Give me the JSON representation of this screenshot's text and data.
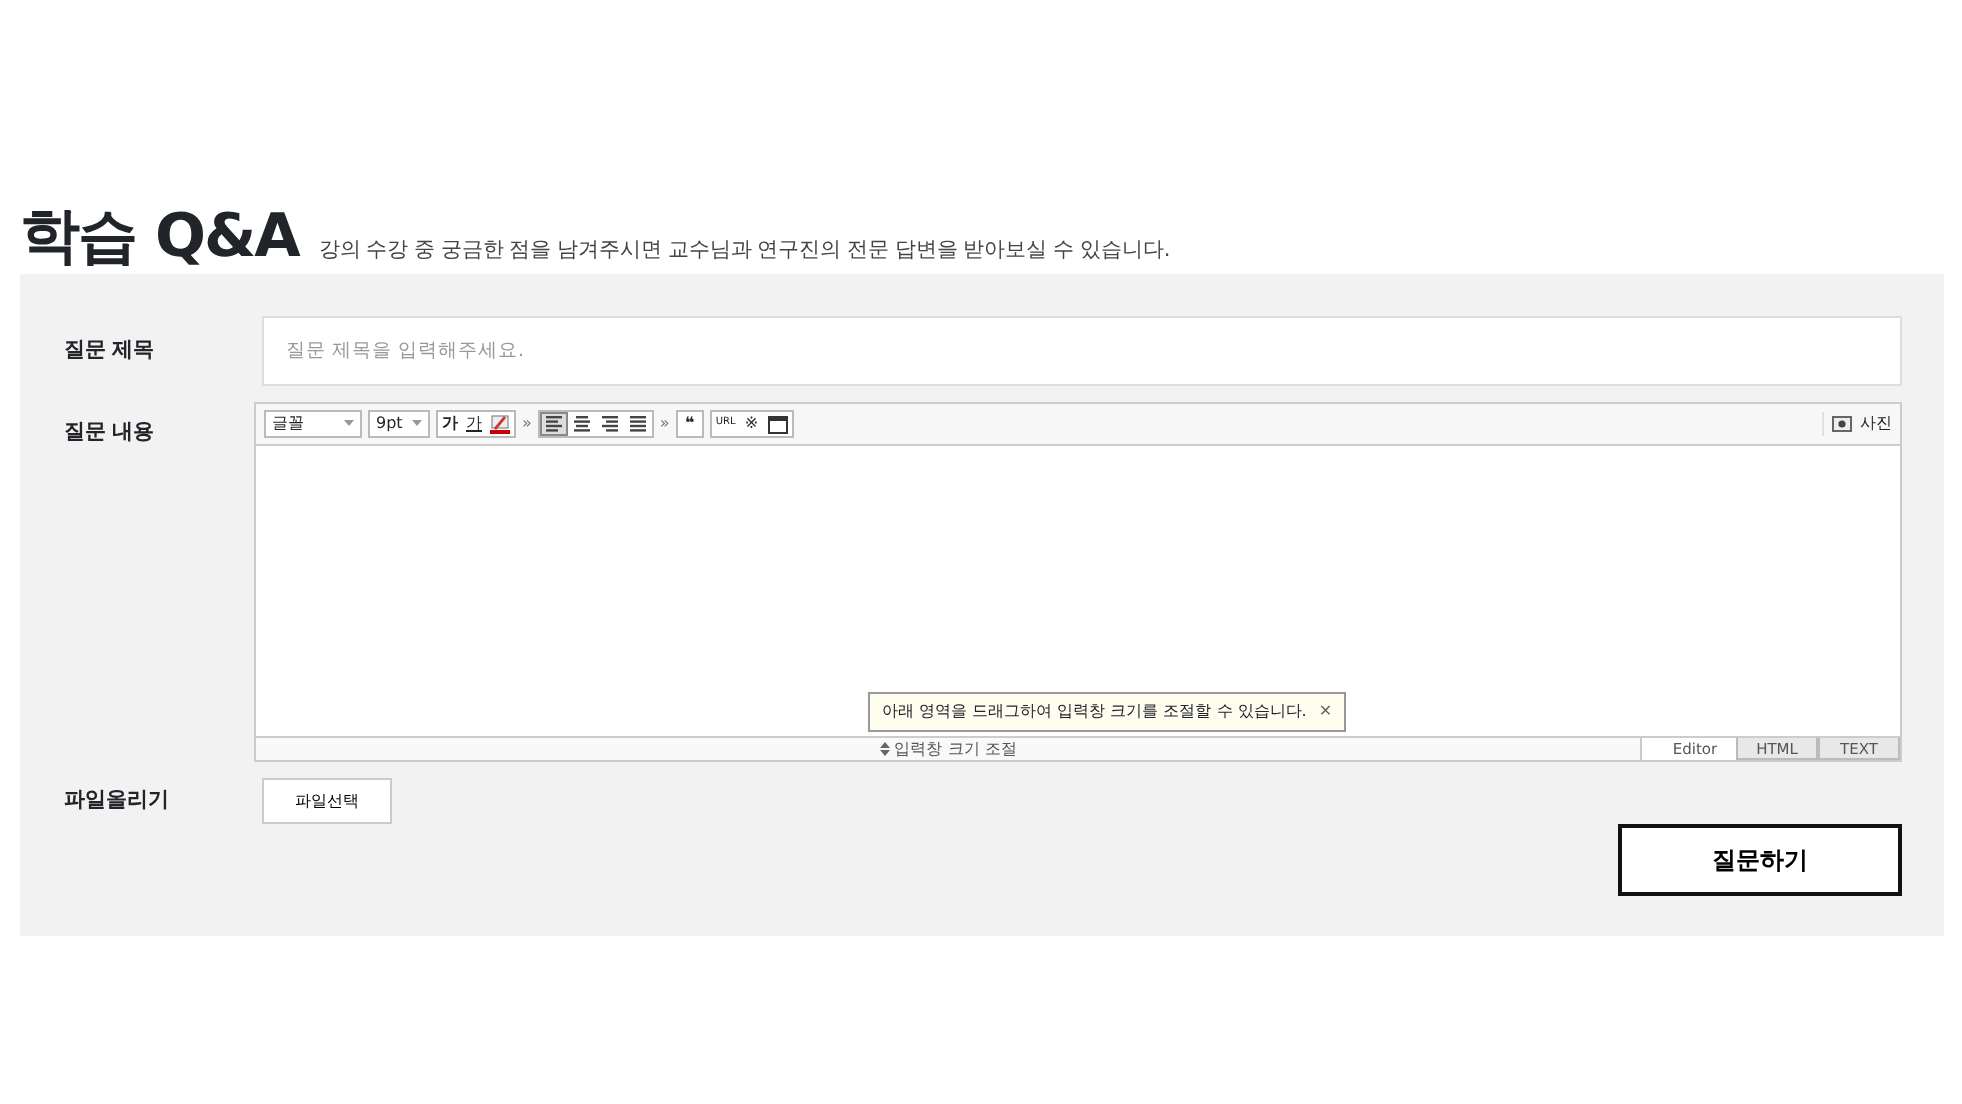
{
  "header": {
    "title": "학습 Q&A",
    "subtitle": "강의 수강 중 궁금한 점을 남겨주시면 교수님과 연구진의 전문 답변을 받아보실 수 있습니다."
  },
  "form": {
    "title_label": "질문 제목",
    "title_placeholder": "질문 제목을 입력해주세요.",
    "content_label": "질문 내용",
    "file_label": "파일올리기",
    "file_button": "파일선택",
    "submit": "질문하기"
  },
  "editor": {
    "font_select": "글꼴",
    "size_select": "9pt",
    "bold": "가",
    "underline": "가",
    "more": [
      "»",
      "»"
    ],
    "align": [
      {
        "selected": true
      },
      {
        "selected": false
      },
      {
        "selected": false
      },
      {
        "selected": false
      }
    ],
    "quote": "❝",
    "url": "URL",
    "special": "※",
    "photo": "사진",
    "tooltip": "아래 영역을 드래그하여 입력창 크기를 조절할 수 있습니다.",
    "tooltip_close": "✕",
    "resize": "입력창 크기 조절",
    "tabs": [
      {
        "label": "Editor",
        "selected": true
      },
      {
        "label": "HTML",
        "selected": false
      },
      {
        "label": "TEXT",
        "selected": false
      }
    ]
  }
}
